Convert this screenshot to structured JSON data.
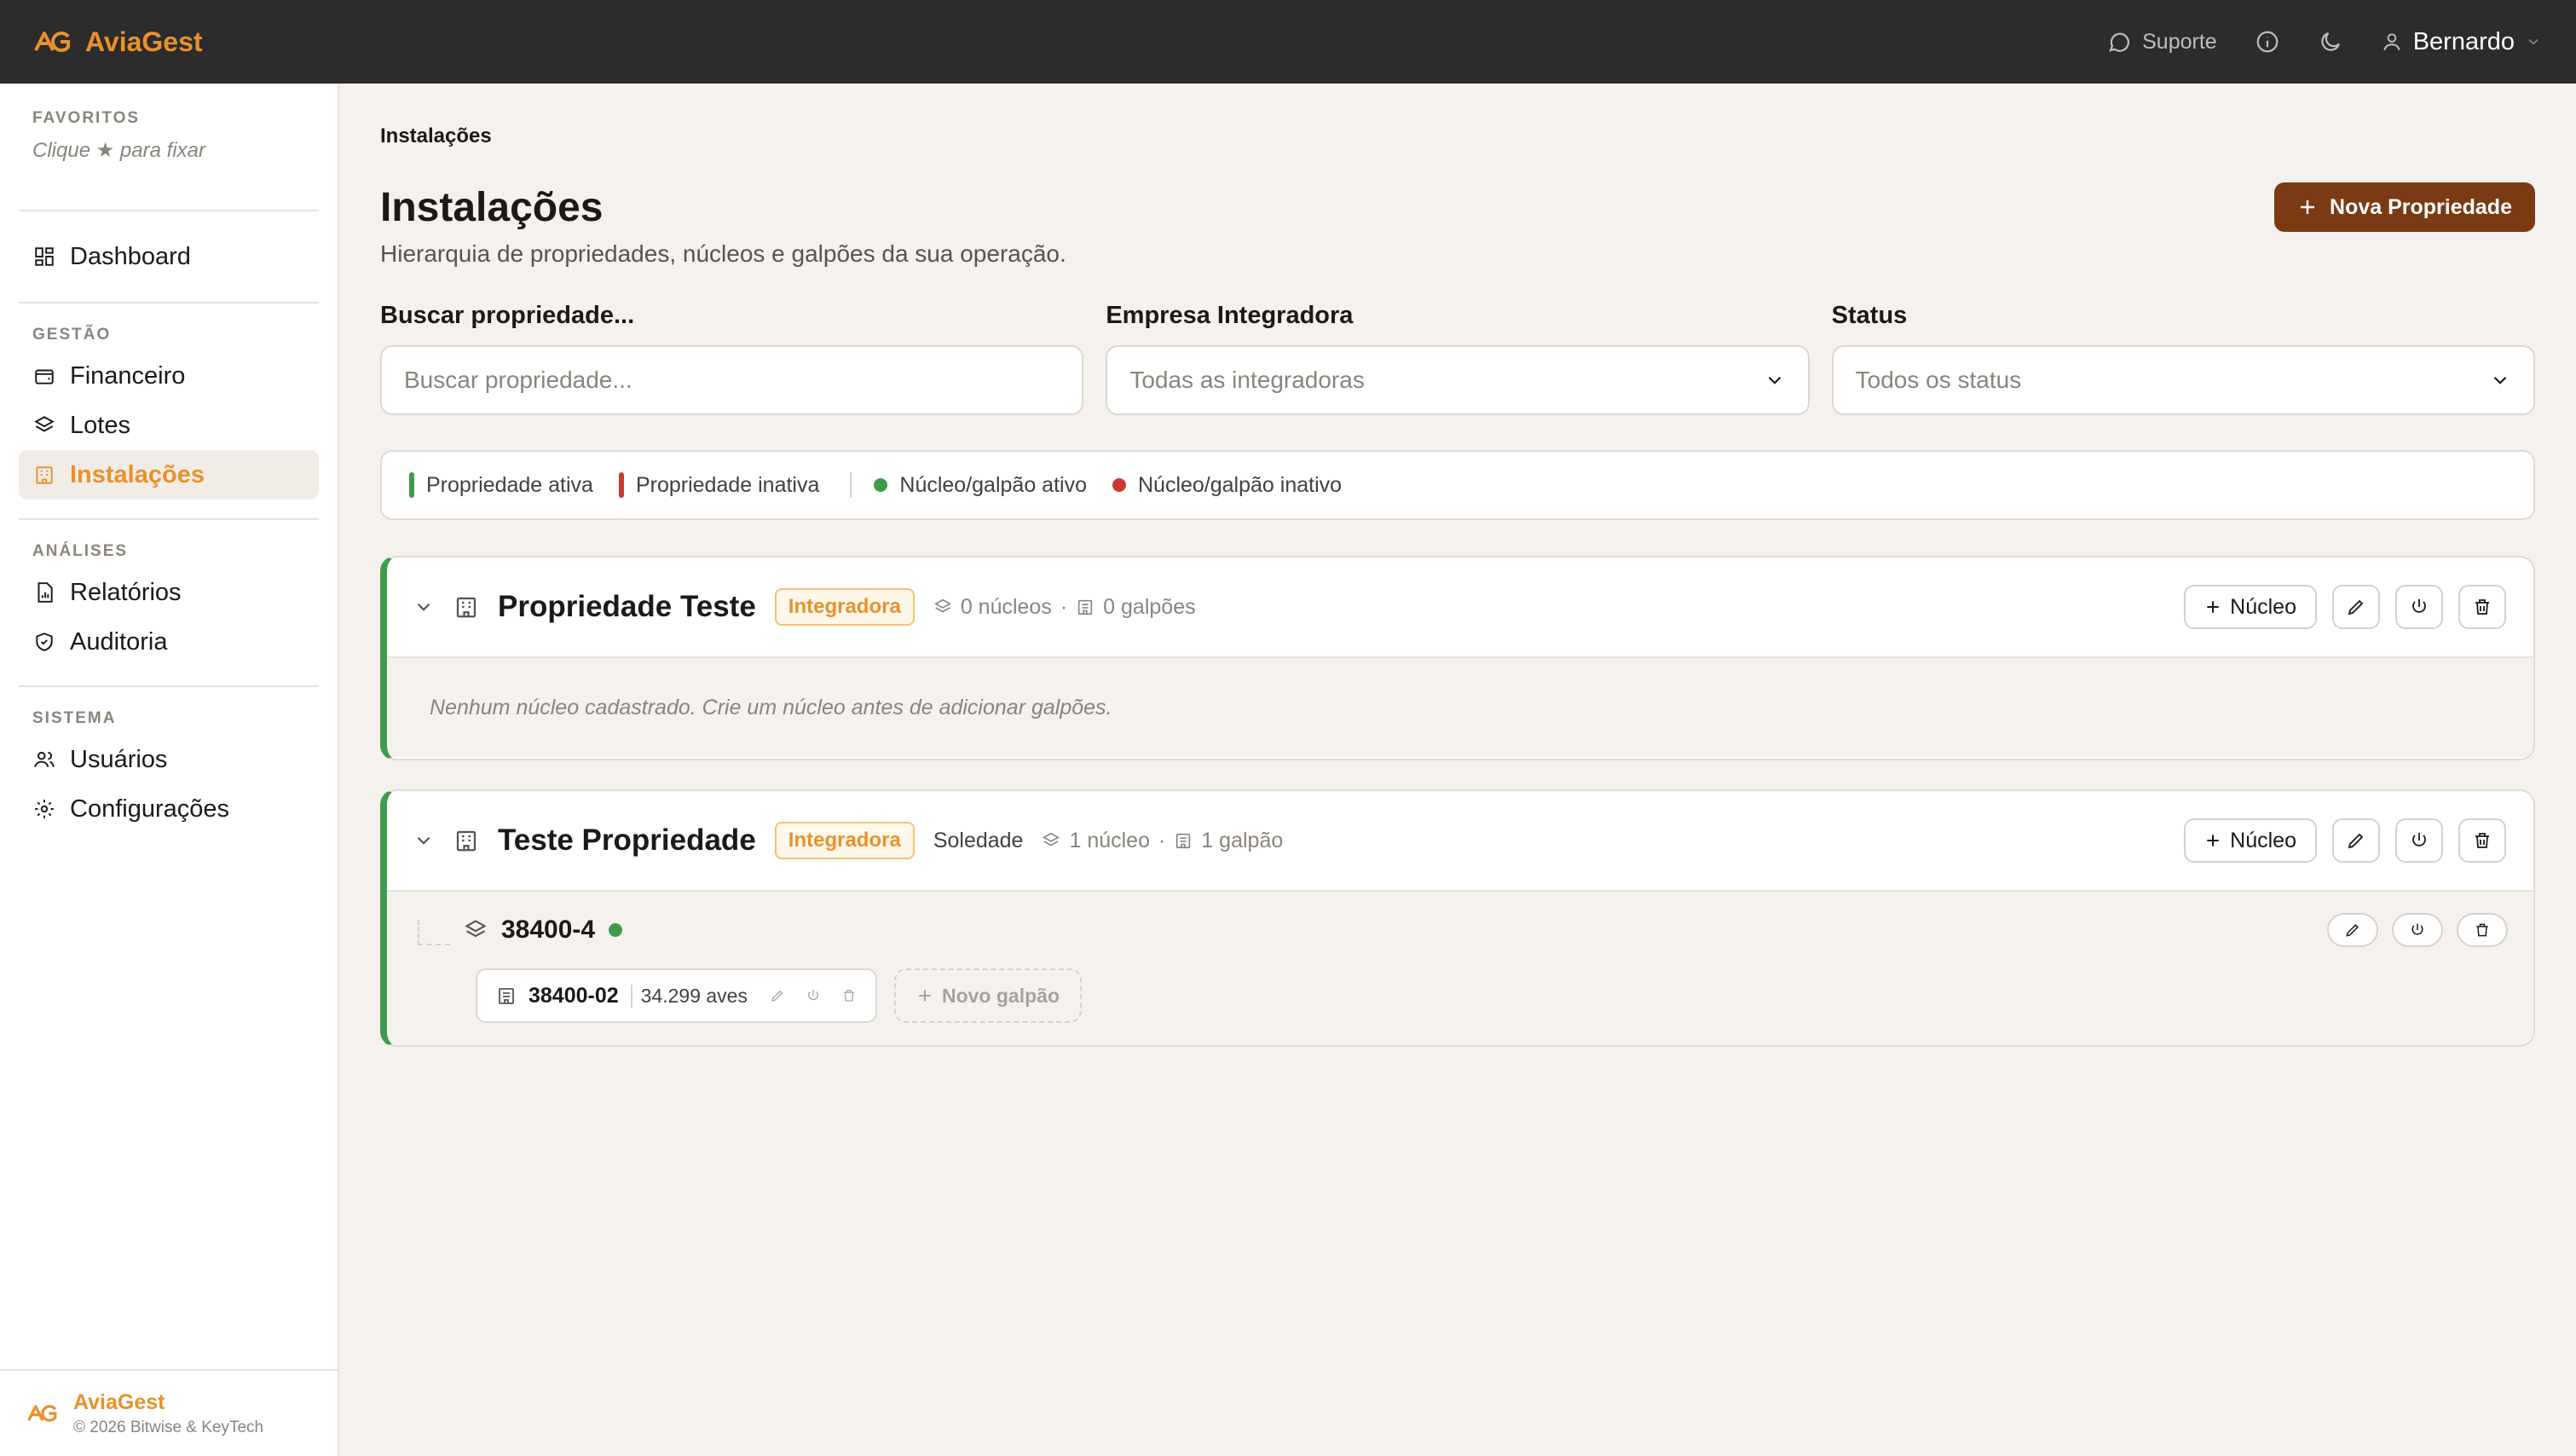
{
  "app": {
    "name": "AviaGest"
  },
  "topbar": {
    "support": "Suporte",
    "user": "Bernardo"
  },
  "sidebar": {
    "favorites": {
      "heading": "FAVORITOS",
      "hint": "Clique ★ para fixar"
    },
    "dashboard": "Dashboard",
    "gestao": {
      "heading": "GESTÃO",
      "items": [
        "Financeiro",
        "Lotes",
        "Instalações"
      ]
    },
    "analises": {
      "heading": "ANÁLISES",
      "items": [
        "Relatórios",
        "Auditoria"
      ]
    },
    "sistema": {
      "heading": "SISTEMA",
      "items": [
        "Usuários",
        "Configurações"
      ]
    },
    "footer": {
      "brand": "AviaGest",
      "copyright": "© 2026 Bitwise & KeyTech"
    }
  },
  "main": {
    "breadcrumb": "Instalações",
    "title": "Instalações",
    "subtitle": "Hierarquia de propriedades, núcleos e galpões da sua operação.",
    "new_button": "Nova Propriedade",
    "filters": {
      "search": {
        "label": "Buscar propriedade...",
        "placeholder": "Buscar propriedade..."
      },
      "integradora": {
        "label": "Empresa Integradora",
        "value": "Todas as integradoras"
      },
      "status": {
        "label": "Status",
        "value": "Todos os status"
      }
    },
    "legend": {
      "prop_active": "Propriedade ativa",
      "prop_inactive": "Propriedade inativa",
      "nucleo_active": "Núcleo/galpão ativo",
      "nucleo_inactive": "Núcleo/galpão inativo"
    },
    "properties": [
      {
        "name": "Propriedade Teste",
        "badge": "Integradora",
        "nucleos": "0 núcleos",
        "galpoes": "0 galpões",
        "nucleo_button": "Núcleo",
        "empty_message": "Nenhum núcleo cadastrado. Crie um núcleo antes de adicionar galpões."
      },
      {
        "name": "Teste Propriedade",
        "badge": "Integradora",
        "city": "Soledade",
        "nucleos": "1 núcleo",
        "galpoes": "1 galpão",
        "nucleo_button": "Núcleo",
        "nucleo": {
          "name": "38400-4",
          "galpao": {
            "name": "38400-02",
            "count": "34.299 aves"
          },
          "new_galpao": "Novo galpão"
        }
      }
    ]
  },
  "colors": {
    "accent": "#e8912d",
    "primary": "#7a3a14",
    "active": "#3f9b4a",
    "inactive": "#c73a32"
  }
}
